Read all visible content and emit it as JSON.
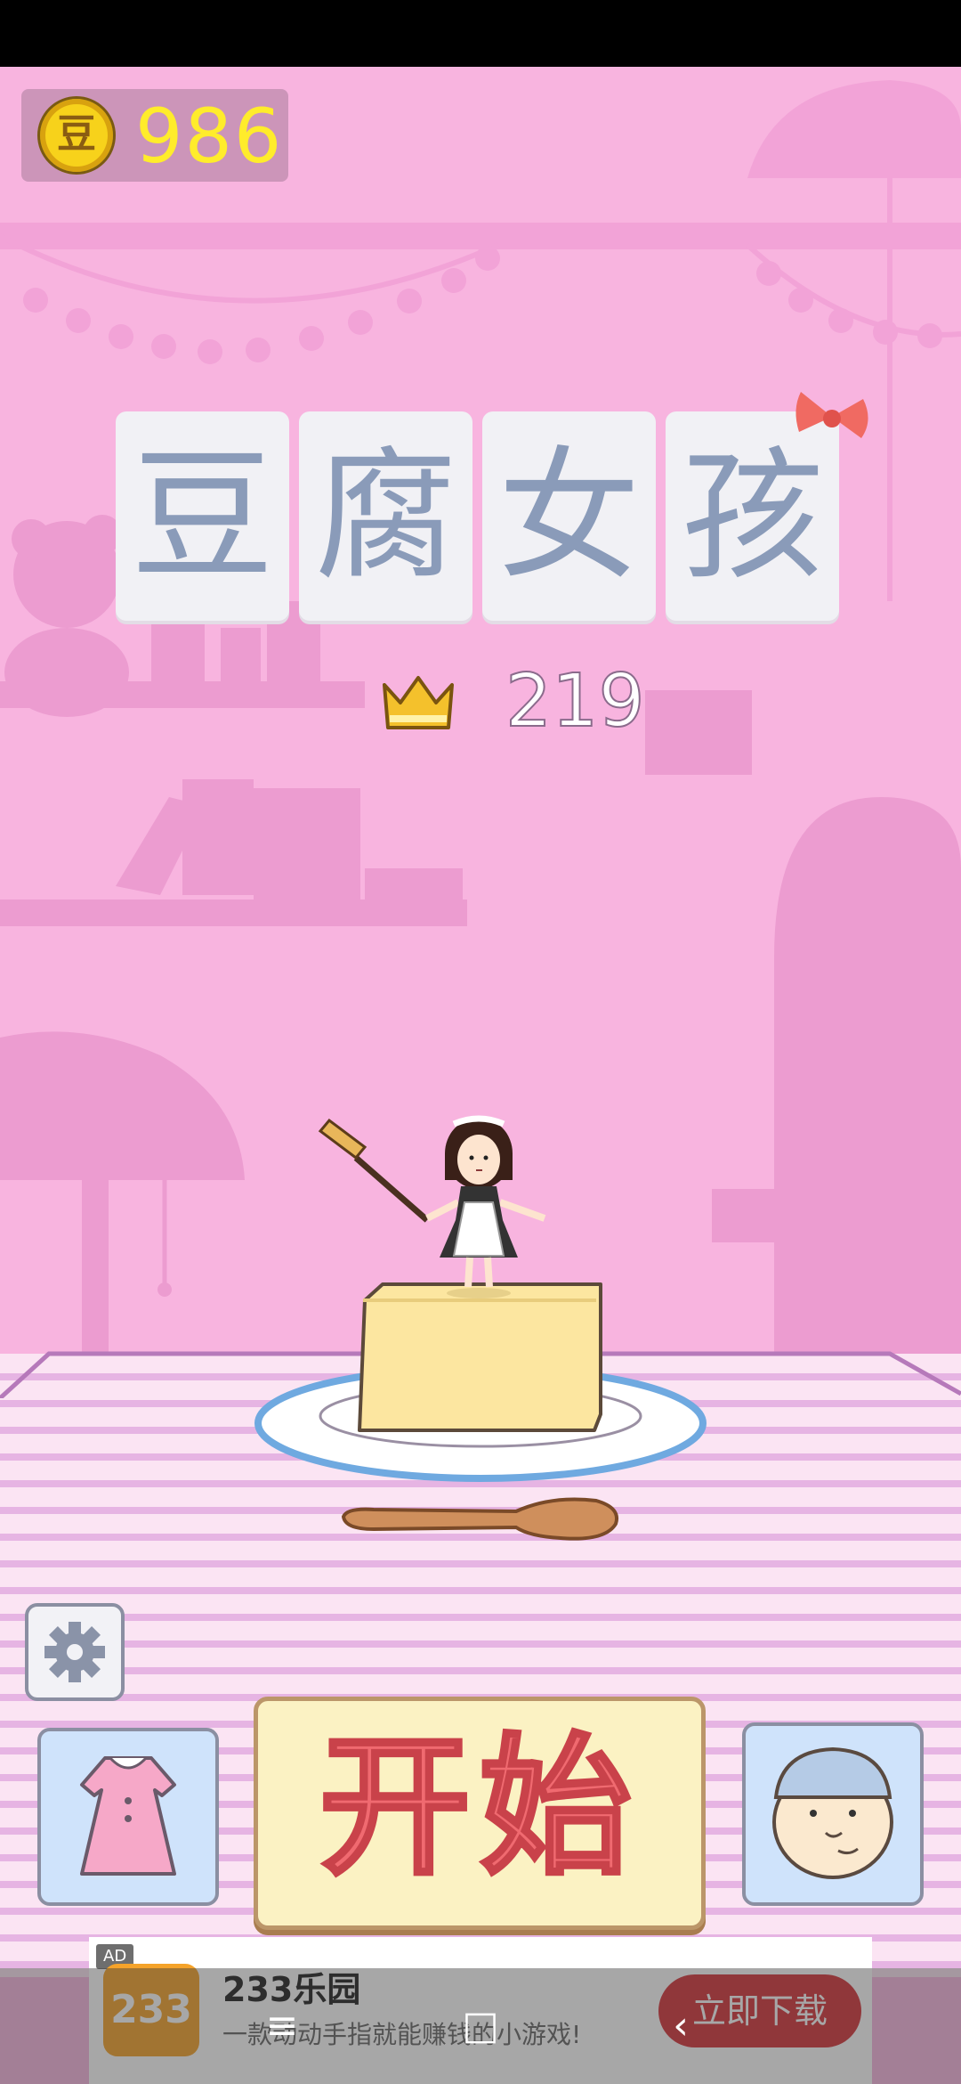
{
  "hud": {
    "coin_symbol": "豆",
    "coins": "986"
  },
  "title": {
    "chars": [
      "豆",
      "腐",
      "女",
      "孩"
    ]
  },
  "best": {
    "score": "219"
  },
  "buttons": {
    "start_label": "开始",
    "settings_icon": "gear-icon",
    "outfit_icon": "dress-icon",
    "chef_icon": "chef-face-icon"
  },
  "ad": {
    "tag": "AD",
    "icon_text": "233",
    "title": "233乐园",
    "description": "一款动动手指就能赚钱的小游戏!",
    "cta": "立即下载"
  },
  "nav": {
    "menu": "≡",
    "home": "□",
    "back": "‹"
  },
  "colors": {
    "background": "#f8b4df",
    "coin_text": "#ffec2b",
    "title_text": "#8a9bb9",
    "start_text": "#f06a70",
    "ad_cta": "#d6333a"
  }
}
